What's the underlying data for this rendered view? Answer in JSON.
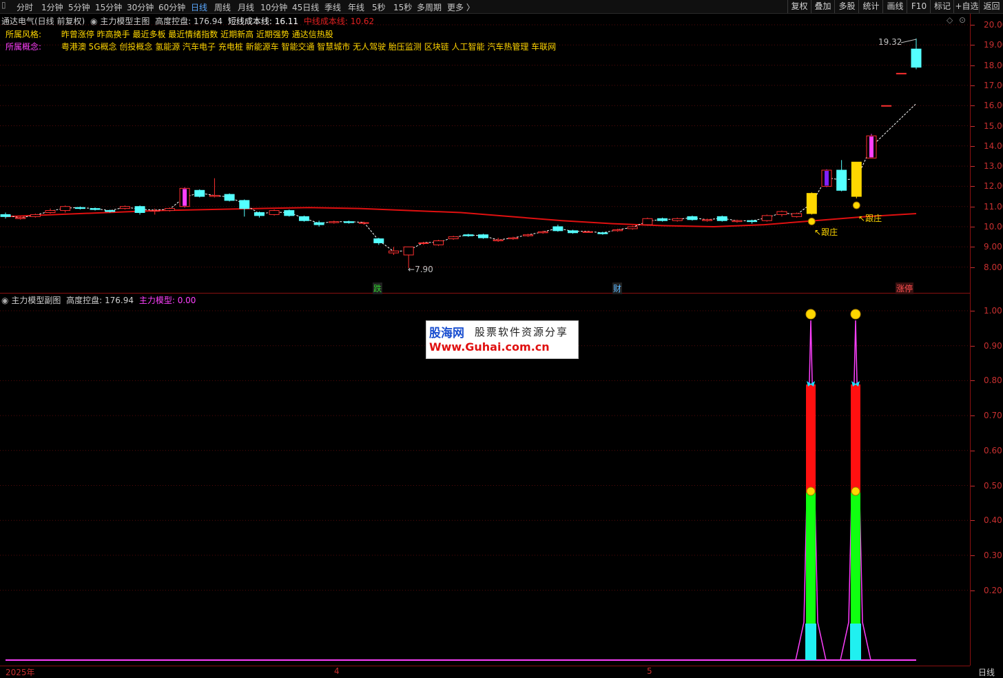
{
  "toolbar": {
    "tabs": [
      "分时",
      "1分钟",
      "5分钟",
      "15分钟",
      "30分钟",
      "60分钟",
      "日线",
      "周线",
      "月线",
      "10分钟",
      "45日线",
      "季线",
      "年线",
      "5秒",
      "15秒",
      "多周期",
      "更多 〉"
    ],
    "active_tab": "日线",
    "right_buttons": [
      "复权",
      "叠加",
      "多股",
      "统计",
      "画线",
      "F10",
      "标记",
      "+自选",
      "返回"
    ]
  },
  "main_header": {
    "stock": "通达电气(日线 前复权)",
    "indicator": "主力模型主图",
    "height_label": "高度控盘: 176.94",
    "short_cost": "短线成本线: 16.11",
    "mid_cost": "中线成本线: 10.62"
  },
  "style_row": {
    "label": "所属风格:",
    "value": "昨曾涨停 昨高换手 最近多板 最近情绪指数 近期新高 近期强势 通达信热股"
  },
  "concept_row": {
    "label": "所属概念:",
    "value": "粤港澳 5G概念 创投概念 氢能源 汽车电子 充电桩 新能源车 智能交通 智慧城市 无人驾驶 胎压监测 区块链 人工智能 汽车热管理 车联网"
  },
  "main_axis": [
    "20.00",
    "19.00",
    "18.00",
    "17.00",
    "16.00",
    "15.00",
    "14.00",
    "13.00",
    "12.00",
    "11.00",
    "10.00",
    "9.00",
    "8.00"
  ],
  "annotations": {
    "high": "19.32",
    "low": "7.90",
    "zhuang1": "跟庄",
    "zhuang2": "跟庄",
    "event1": "跌",
    "event2": "财",
    "event3": "涨停"
  },
  "sub_header": {
    "indicator": "主力模型副图",
    "height_label": "高度控盘: 176.94",
    "model_label": "主力模型: 0.00"
  },
  "sub_axis": [
    "1.00",
    "0.90",
    "0.80",
    "0.70",
    "0.60",
    "0.50",
    "0.40",
    "0.30",
    "0.20"
  ],
  "x_axis": [
    "2025年",
    "4",
    "5"
  ],
  "axis_period": "日线",
  "watermark": {
    "brand": "股海网",
    "tagline": "股票软件资源分享",
    "url": "Www.Guhai.com.cn"
  },
  "colors": {
    "up": "#ff3030",
    "down": "#54ffff",
    "ma": "#e01010",
    "bg": "#000000",
    "yellow": "#ffd700",
    "magenta": "#ff40ff"
  },
  "chart_data": {
    "type": "candlestick",
    "ylim": [
      7.5,
      20.3
    ],
    "candles": [
      [
        10.6,
        10.5,
        10.7,
        10.4
      ],
      [
        10.4,
        10.45,
        10.5,
        10.35
      ],
      [
        10.5,
        10.6,
        10.65,
        10.45
      ],
      [
        10.7,
        10.8,
        10.9,
        10.65
      ],
      [
        10.8,
        11.0,
        11.05,
        10.7
      ],
      [
        10.95,
        10.9,
        11.0,
        10.85
      ],
      [
        10.9,
        10.85,
        10.95,
        10.8
      ],
      [
        10.8,
        10.75,
        10.85,
        10.7
      ],
      [
        10.9,
        11.0,
        11.05,
        10.85
      ],
      [
        11.0,
        10.7,
        11.05,
        10.6
      ],
      [
        10.8,
        10.8,
        10.9,
        10.6
      ],
      [
        10.8,
        10.9,
        10.95,
        10.75
      ],
      [
        11.0,
        11.9,
        11.95,
        10.95
      ],
      [
        11.8,
        11.5,
        11.85,
        11.45
      ],
      [
        11.5,
        11.55,
        12.4,
        11.45
      ],
      [
        11.6,
        11.3,
        11.65,
        11.25
      ],
      [
        11.3,
        10.9,
        11.35,
        10.5
      ],
      [
        10.7,
        10.55,
        10.75,
        10.45
      ],
      [
        10.6,
        10.8,
        10.85,
        10.55
      ],
      [
        10.8,
        10.55,
        10.85,
        10.5
      ],
      [
        10.5,
        10.3,
        10.55,
        10.25
      ],
      [
        10.2,
        10.1,
        10.3,
        10.0
      ],
      [
        10.2,
        10.25,
        10.3,
        10.15
      ],
      [
        10.25,
        10.2,
        10.3,
        10.15
      ],
      [
        10.2,
        10.2,
        10.25,
        10.1
      ],
      [
        9.4,
        9.2,
        9.45,
        9.1
      ],
      [
        8.7,
        8.8,
        9.0,
        8.6
      ],
      [
        8.6,
        9.0,
        9.0,
        7.95
      ],
      [
        9.2,
        9.2,
        9.25,
        9.1
      ],
      [
        9.1,
        9.3,
        9.35,
        9.05
      ],
      [
        9.4,
        9.5,
        9.55,
        9.35
      ],
      [
        9.6,
        9.55,
        9.65,
        9.5
      ],
      [
        9.6,
        9.45,
        9.65,
        9.4
      ],
      [
        9.3,
        9.35,
        9.45,
        9.25
      ],
      [
        9.4,
        9.45,
        9.5,
        9.35
      ],
      [
        9.55,
        9.6,
        9.65,
        9.5
      ],
      [
        9.7,
        9.75,
        9.8,
        9.65
      ],
      [
        10.0,
        9.8,
        10.1,
        9.75
      ],
      [
        9.8,
        9.7,
        9.85,
        9.65
      ],
      [
        9.75,
        9.75,
        9.8,
        9.7
      ],
      [
        9.7,
        9.65,
        9.75,
        9.6
      ],
      [
        9.8,
        9.85,
        9.9,
        9.75
      ],
      [
        9.9,
        10.0,
        10.05,
        9.85
      ],
      [
        10.1,
        10.4,
        10.45,
        10.05
      ],
      [
        10.4,
        10.3,
        10.45,
        10.25
      ],
      [
        10.3,
        10.4,
        10.45,
        10.25
      ],
      [
        10.5,
        10.35,
        10.55,
        10.3
      ],
      [
        10.3,
        10.35,
        10.4,
        10.25
      ],
      [
        10.5,
        10.3,
        10.55,
        10.25
      ],
      [
        10.25,
        10.3,
        10.35,
        10.2
      ],
      [
        10.3,
        10.25,
        10.35,
        10.15
      ],
      [
        10.3,
        10.55,
        10.6,
        10.25
      ],
      [
        10.6,
        10.75,
        10.8,
        10.5
      ],
      [
        10.5,
        10.65,
        10.7,
        10.45
      ],
      [
        10.65,
        11.65,
        11.7,
        10.6
      ],
      [
        12.0,
        12.8,
        12.85,
        11.95
      ],
      [
        12.8,
        11.8,
        13.3,
        11.75
      ],
      [
        11.5,
        13.2,
        13.2,
        11.4
      ],
      [
        14.5,
        13.4,
        14.6,
        13.4
      ],
      [
        16.0,
        16.0,
        16.0,
        16.0
      ],
      [
        17.6,
        17.6,
        17.6,
        17.6
      ],
      [
        18.8,
        17.9,
        19.32,
        17.8
      ]
    ],
    "ma_line": [
      10.5,
      10.6,
      10.7,
      10.8,
      10.85,
      10.9,
      10.95,
      10.9,
      10.8,
      10.7,
      10.5,
      10.3,
      10.15,
      10.05,
      10.0,
      10.1,
      10.3,
      10.5,
      10.65
    ],
    "sub_series": [
      0,
      0,
      1.0,
      0,
      0,
      1.0,
      0,
      0
    ]
  }
}
